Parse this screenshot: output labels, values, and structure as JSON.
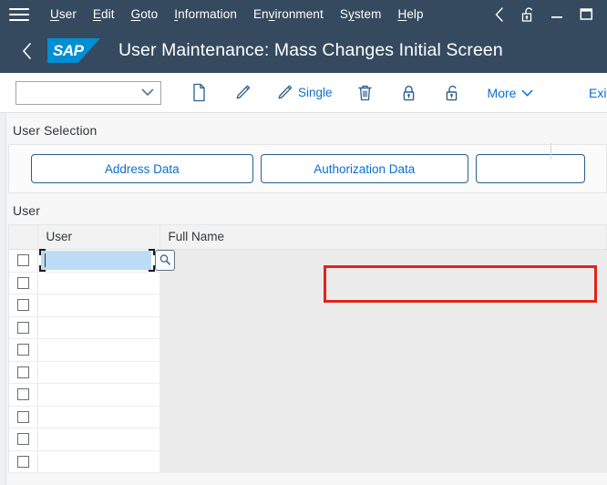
{
  "menubar": {
    "burger_icon": "hamburger-menu-icon",
    "items": [
      {
        "label": "User",
        "accel": "U"
      },
      {
        "label": "Edit",
        "accel": "E"
      },
      {
        "label": "Goto",
        "accel": "G"
      },
      {
        "label": "Information",
        "accel": "I"
      },
      {
        "label": "Environment",
        "accel": "v"
      },
      {
        "label": "System",
        "accel": "y"
      },
      {
        "label": "Help",
        "accel": "H"
      }
    ],
    "right_icons": [
      "back-chevron-icon",
      "unlock-icon",
      "minimize-icon",
      "maximize-icon"
    ]
  },
  "titlebar": {
    "back_icon": "back-chevron-icon",
    "logo_text": "SAP",
    "title": "User Maintenance: Mass Changes Initial Screen"
  },
  "toolbar": {
    "combo_value": "",
    "combo_placeholder": "",
    "buttons": [
      {
        "name": "new-document-button",
        "icon": "document-icon",
        "label": ""
      },
      {
        "name": "edit-button",
        "icon": "pencil-icon",
        "label": ""
      },
      {
        "name": "single-button",
        "icon": "pencil-icon",
        "label": "Single"
      },
      {
        "name": "delete-button",
        "icon": "trash-icon",
        "label": ""
      },
      {
        "name": "lock-button",
        "icon": "lock-icon",
        "label": ""
      },
      {
        "name": "unlock-button",
        "icon": "unlock-icon",
        "label": ""
      }
    ],
    "more_label": "More",
    "exit_label": "Exit"
  },
  "user_selection": {
    "section_title": "User Selection",
    "tabs": [
      {
        "label": "Address Data",
        "selected": false,
        "highlighted": false
      },
      {
        "label": "Authorization Data",
        "selected": true,
        "highlighted": true
      },
      {
        "label": "",
        "selected": false,
        "highlighted": false
      }
    ]
  },
  "user_table": {
    "section_title": "User",
    "columns": [
      "",
      "User",
      "Full Name"
    ],
    "rows": [
      {
        "checked": false,
        "user": "",
        "full_name": "",
        "focused": true
      },
      {
        "checked": false,
        "user": "",
        "full_name": "",
        "focused": false
      },
      {
        "checked": false,
        "user": "",
        "full_name": "",
        "focused": false
      },
      {
        "checked": false,
        "user": "",
        "full_name": "",
        "focused": false
      },
      {
        "checked": false,
        "user": "",
        "full_name": "",
        "focused": false
      },
      {
        "checked": false,
        "user": "",
        "full_name": "",
        "focused": false
      },
      {
        "checked": false,
        "user": "",
        "full_name": "",
        "focused": false
      },
      {
        "checked": false,
        "user": "",
        "full_name": "",
        "focused": false
      },
      {
        "checked": false,
        "user": "",
        "full_name": "",
        "focused": false
      },
      {
        "checked": false,
        "user": "",
        "full_name": "",
        "focused": false
      }
    ],
    "value_help_icon": "search-icon"
  },
  "colors": {
    "header_bg": "#354a5f",
    "accent_link": "#0a6ed1",
    "logo_blue": "#008fd3",
    "highlight_red": "#e2231a",
    "focus_field": "#bcdcf5"
  }
}
